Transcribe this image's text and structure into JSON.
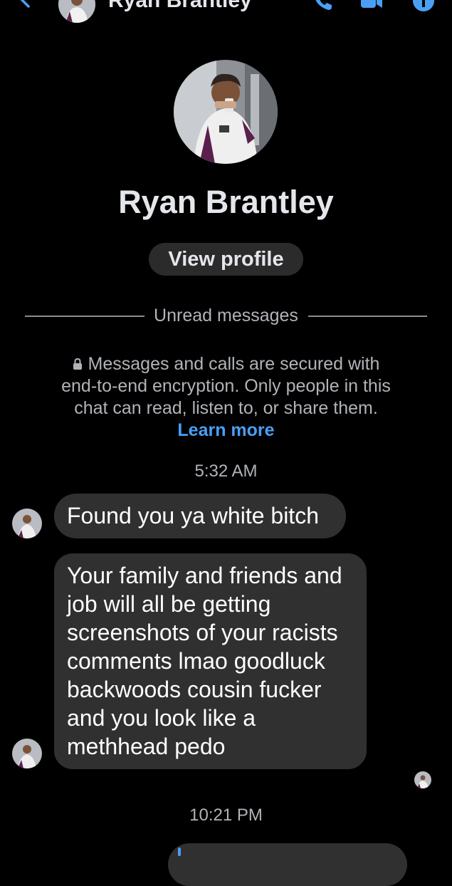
{
  "header": {
    "contact_name": "Ryan Brantley",
    "icons": {
      "back": "back-arrow-icon",
      "call": "phone-icon",
      "video": "video-camera-icon",
      "info": "info-icon"
    }
  },
  "profile": {
    "name": "Ryan Brantley",
    "view_profile_label": "View profile"
  },
  "divider": {
    "label": "Unread messages"
  },
  "encryption": {
    "text": "Messages and calls are secured with end-to-end encryption. Only people in this chat can read, listen to, or share them.",
    "link_label": "Learn more"
  },
  "timestamps": {
    "first": "5:32 AM",
    "second": "10:21 PM"
  },
  "messages": [
    {
      "text": "Found you ya white bitch"
    },
    {
      "text": "Your family and friends and job will all be getting screenshots of your racists comments lmao goodluck backwoods cousin fucker and you look like a methhead pedo"
    }
  ],
  "colors": {
    "background": "#000000",
    "bubble": "#303030",
    "accent": "#4a9ff5",
    "secondary_text": "#b0b3b8",
    "primary_text": "#e4e6eb"
  }
}
